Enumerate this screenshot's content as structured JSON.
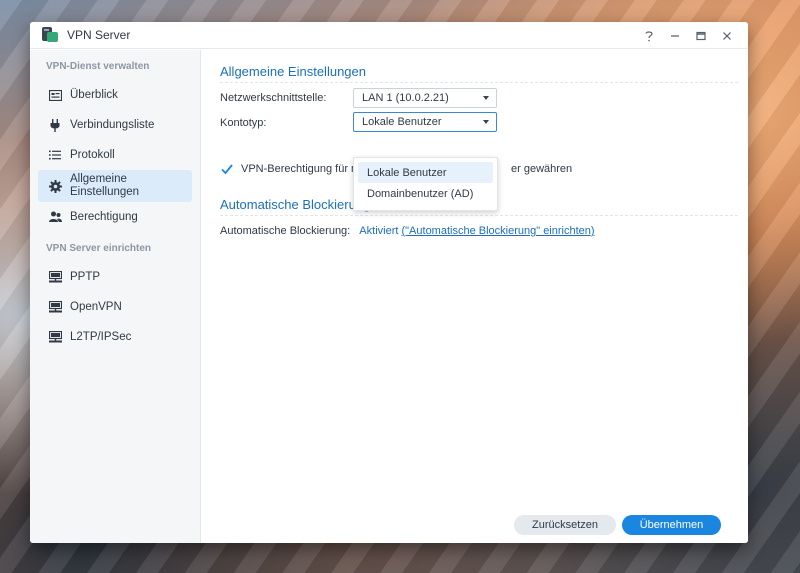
{
  "window": {
    "title": "VPN Server",
    "controls": [
      "help-icon",
      "minimize-icon",
      "maximize-icon",
      "close-icon"
    ]
  },
  "sidebar": {
    "sections": [
      {
        "title": "VPN-Dienst verwalten",
        "items": [
          {
            "label": "Überblick",
            "icon": "overview-icon",
            "active": false
          },
          {
            "label": "Verbindungsliste",
            "icon": "plug-icon",
            "active": false
          },
          {
            "label": "Protokoll",
            "icon": "list-icon",
            "active": false
          },
          {
            "label": "Allgemeine Einstellungen",
            "icon": "gear-icon",
            "active": true
          },
          {
            "label": "Berechtigung",
            "icon": "users-icon",
            "active": false
          }
        ]
      },
      {
        "title": "VPN Server einrichten",
        "items": [
          {
            "label": "PPTP",
            "icon": "server-icon",
            "active": false
          },
          {
            "label": "OpenVPN",
            "icon": "server-icon",
            "active": false
          },
          {
            "label": "L2TP/IPSec",
            "icon": "server-icon",
            "active": false
          }
        ]
      }
    ]
  },
  "main": {
    "general": {
      "title": "Allgemeine Einstellungen",
      "interface_label": "Netzwerkschnittstelle:",
      "interface_value": "LAN 1 (10.0.2.21)",
      "account_type_label": "Kontotyp:",
      "account_type_value": "Lokale Benutzer",
      "account_type_options": [
        "Lokale Benutzer",
        "Domainbenutzer (AD)"
      ],
      "vpn_permission_text_left": "VPN-Berechtigung für ne",
      "vpn_permission_text_right": "er gewähren",
      "vpn_permission_checked": true
    },
    "blocking": {
      "title": "Automatische Blockierung",
      "label": "Automatische Blockierung:",
      "value": "Aktiviert",
      "link": "(\"Automatische Blockierung\" einrichten)"
    }
  },
  "footer": {
    "reset_label": "Zurücksetzen",
    "apply_label": "Übernehmen"
  },
  "colors": {
    "accent": "#1b86e0",
    "section_title": "#1c6fb8",
    "active_item_bg": "#dcebfa"
  }
}
